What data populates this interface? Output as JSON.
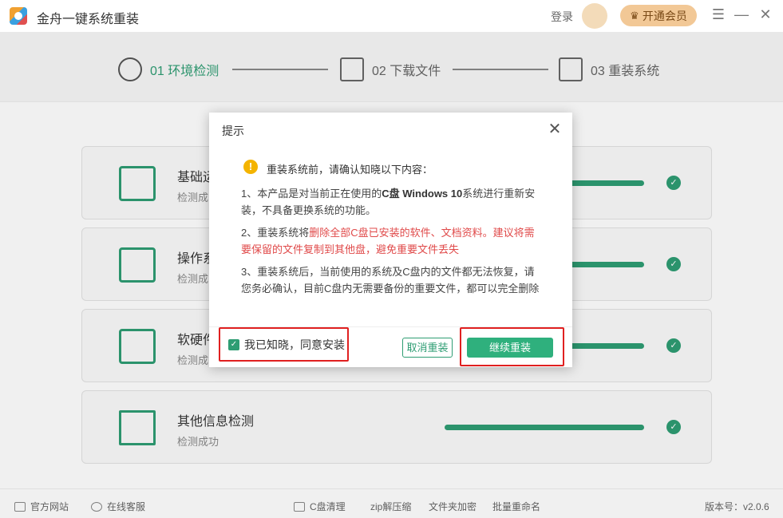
{
  "app": {
    "title": "金舟一键系统重装",
    "login": "登录",
    "vip_button": "开通会员",
    "menu_icon": "menu-icon",
    "minimize_icon": "minimize-icon",
    "close_icon": "close-icon"
  },
  "steps": [
    {
      "label": "01 环境检测",
      "state": "active",
      "icon": "gauge-icon"
    },
    {
      "label": "02 下载文件",
      "state": "pending",
      "icon": "download-icon"
    },
    {
      "label": "03 重装系统",
      "state": "pending",
      "icon": "reinstall-icon"
    }
  ],
  "checks": [
    {
      "name": "基础运",
      "status": "检测成",
      "progress": 1.0,
      "icon": "laptop-icon"
    },
    {
      "name": "操作系",
      "status": "检测成",
      "progress": 1.0,
      "icon": "grid-icon"
    },
    {
      "name": "软硬件",
      "status": "检测成",
      "progress": 1.0,
      "icon": "code-icon"
    },
    {
      "name": "其他信息检测",
      "status": "检测成功",
      "progress": 1.0,
      "icon": "document-icon"
    }
  ],
  "footer": {
    "official_site": "官方网站",
    "online_service": "在线客服",
    "tools": [
      "C盘清理",
      "zip解压缩",
      "文件夹加密",
      "批量重命名"
    ],
    "version": "版本号：v2.0.6"
  },
  "modal": {
    "title": "提示",
    "intro": "重装系统前，请确认知晓以下内容：",
    "item1_a": "1、本产品是对当前正在使用的",
    "item1_b": "C盘 Windows 10",
    "item1_c": "系统进行重新安装，不具备更换系统的功能。",
    "item2_a": "2、重装系统将",
    "item2_b": "删除全部C盘已安装的软件、文档资料。建议将需要保留的文件复制到其他盘，避免重要文件丢失",
    "item3": "3、重装系统后，当前使用的系统及C盘内的文件都无法恢复，请您务必确认，目前C盘内无需要备份的重要文件，都可以完全删除",
    "agree_label": "我已知晓，同意安装",
    "agree_checked": true,
    "cancel_label": "取消重装",
    "continue_label": "继续重装"
  },
  "colors": {
    "accent": "#2e9d73",
    "warning": "#e04a4a",
    "highlight_box": "#e02020",
    "vip": "#f2c896"
  }
}
